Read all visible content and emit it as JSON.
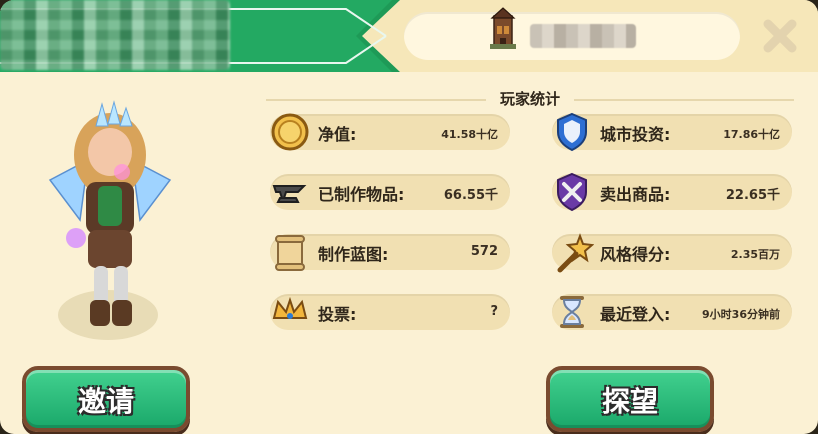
{
  "header": {
    "player_name_blurred": true,
    "city_name_blurred": true,
    "banner_color": "#1e9a57",
    "icons": {
      "city": "castle-city-icon",
      "close": "close-x-icon"
    }
  },
  "stats": {
    "title": "玩家统计",
    "left": [
      {
        "icon": "gold-coin-icon",
        "label": "净值:",
        "value": "41.58十亿"
      },
      {
        "icon": "anvil-icon",
        "label": "已制作物品:",
        "value": "66.55千"
      },
      {
        "icon": "scroll-blueprint-icon",
        "label": "制作蓝图:",
        "value": "572"
      },
      {
        "icon": "crown-icon",
        "label": "投票:",
        "value": "?"
      }
    ],
    "right": [
      {
        "icon": "city-shield-icon",
        "label": "城市投资:",
        "value": "17.86十亿"
      },
      {
        "icon": "crossed-tools-shield-icon",
        "label": "卖出商品:",
        "value": "22.65千"
      },
      {
        "icon": "star-wand-icon",
        "label": "风格得分:",
        "value": "2.35百万"
      },
      {
        "icon": "hourglass-icon",
        "label": "最近登入:",
        "value": "9小时36分钟前"
      }
    ]
  },
  "buttons": {
    "invite": "邀请",
    "visit": "探望"
  },
  "colors": {
    "panel_bg": "#fbf1d4",
    "stat_bg": "#f1e0b2",
    "button_green": "#22b574",
    "button_border": "#7a4b2f"
  }
}
